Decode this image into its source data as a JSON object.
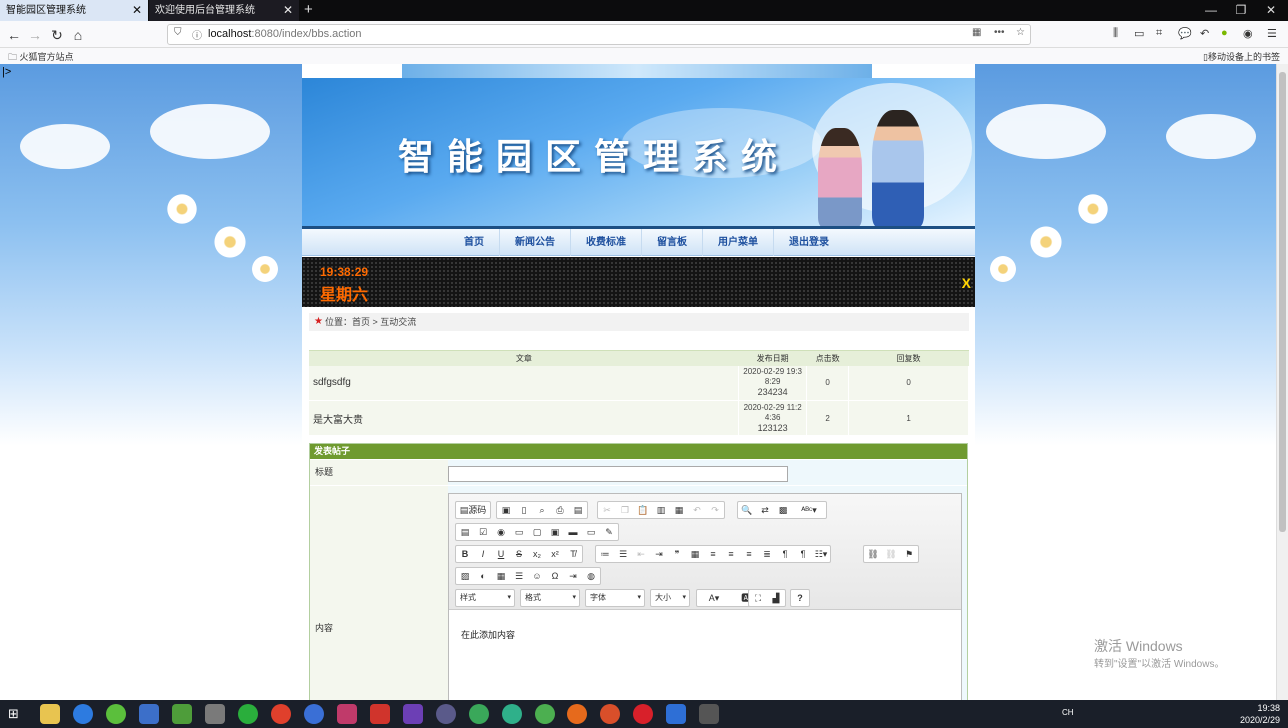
{
  "browser": {
    "tabs": [
      {
        "label": "智能园区管理系统",
        "active": true
      },
      {
        "label": "欢迎使用后台管理系统",
        "active": false
      }
    ],
    "new_tab": "+",
    "url": {
      "host": "localhost",
      "rest": ":8080/index/bbs.action"
    },
    "bookmarks_left": "火狐官方站点",
    "bookmarks_right": "移动设备上的书签"
  },
  "page": {
    "stray_text": "|>",
    "site_title": "智能园区管理系统",
    "menu": [
      "首页",
      "新闻公告",
      "收费标准",
      "留言板",
      "用户菜单",
      "退出登录"
    ],
    "clock": {
      "time": "19:38:29",
      "day": "星期六",
      "scroll_char": "X"
    },
    "breadcrumb": {
      "label": "位置：",
      "home": "首页",
      "sep": " > ",
      "current": "互动交流"
    },
    "list": {
      "headers": [
        "文章",
        "发布日期",
        "点击数",
        "回复数"
      ],
      "rows": [
        {
          "title": "sdfgsdfg",
          "date1": "2020-02-29 19:3",
          "date2": "8:29",
          "date3": "234234",
          "clicks": "0",
          "replies": "0"
        },
        {
          "title": "是大富大贵",
          "date1": "2020-02-29 11:2",
          "date2": "4:36",
          "date3": "123123",
          "clicks": "2",
          "replies": "1"
        }
      ]
    },
    "form": {
      "header": "发表帖子",
      "title_label": "标题",
      "title_value": "",
      "content_label": "内容",
      "editor": {
        "source_label": "源码",
        "combo_style": "样式",
        "combo_format": "格式",
        "combo_font": "字体",
        "combo_size": "大小",
        "help": "?",
        "content": "在此添加内容"
      }
    },
    "watermark": {
      "line1": "激活 Windows",
      "line2": "转到\"设置\"以激活 Windows。"
    }
  },
  "taskbar": {
    "lang": "CH",
    "time": "19:38",
    "date": "2020/2/29"
  },
  "colors": {
    "accent_green": "#6f9a2f",
    "menu_text": "#1d4f9e",
    "ticker_orange": "#ff6a00"
  }
}
